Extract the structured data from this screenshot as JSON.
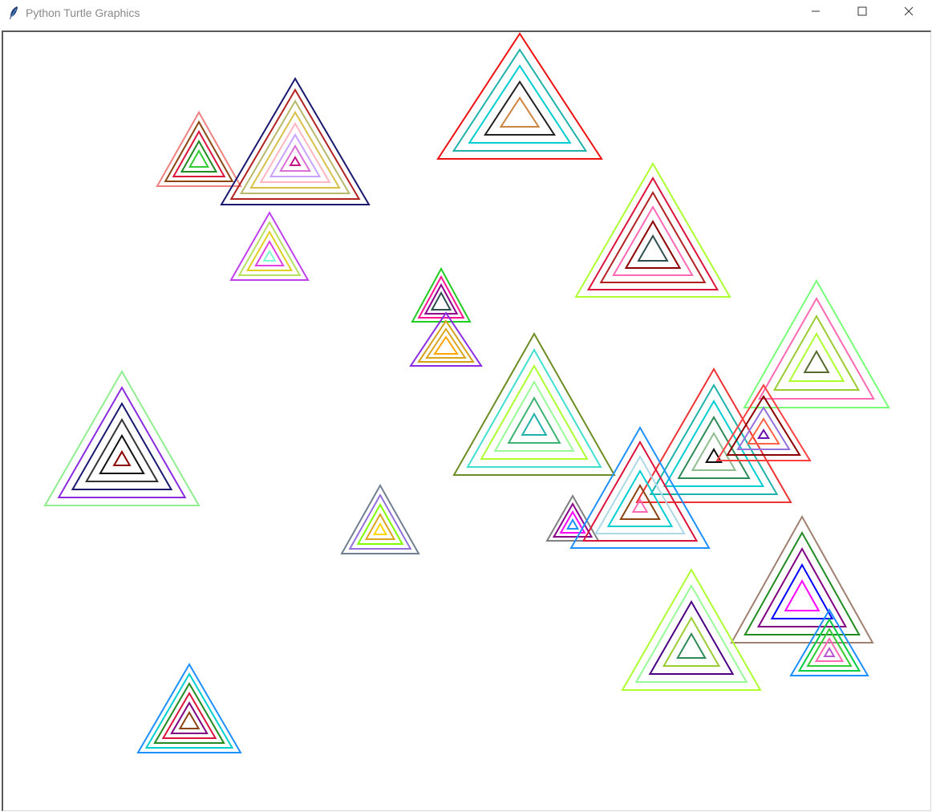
{
  "window": {
    "title": "Python Turtle Graphics",
    "icon": "feather-icon",
    "controls": {
      "minimize_icon": "minimize-icon",
      "maximize_icon": "maximize-icon",
      "close_icon": "close-icon"
    }
  },
  "canvas": {
    "background": "#ffffff",
    "description_shape": "nested-triangle",
    "triangle_groups": [
      {
        "colors": [
          "#f08080",
          "#8b4513",
          "#dc143c",
          "#228b22",
          "#32cd32",
          "#00c000",
          "#f0e68c",
          "#ffe4b5"
        ]
      },
      {
        "colors": [
          "#191970",
          "#b22222",
          "#b8b86b",
          "#d8c04a",
          "#ffb6c1",
          "#c8a2ff",
          "#da70d6",
          "#c71585",
          "#2e8b57",
          "#8fbc8f",
          "#4b0082",
          "#ff69b4"
        ]
      },
      {
        "colors": [
          "#ee1111",
          "#20b2aa",
          "#00ced1",
          "#222222",
          "#cd853f",
          "#4169e1",
          "#7cfc00"
        ]
      },
      {
        "colors": [
          "#c040f0",
          "#b8e060",
          "#e0d020",
          "#e040e0",
          "#7fffd4",
          "#20b2aa",
          "#00e0e0"
        ]
      },
      {
        "colors": [
          "#adff2f",
          "#dc143c",
          "#b22222",
          "#ff69b4",
          "#8b0000",
          "#2f4f4f",
          "#ee82ee"
        ]
      },
      {
        "colors": [
          "#22cc22",
          "#ff1493",
          "#8b008b",
          "#2f4f4f",
          "#1e90ff",
          "#ffffff"
        ]
      },
      {
        "colors": [
          "#8a2be2",
          "#d4a017",
          "#daa520",
          "#ffa500",
          "#1e1e8b",
          "#ff00ff"
        ]
      },
      {
        "colors": [
          "#77ff77",
          "#ff69b4",
          "#9acd32",
          "#adff2f",
          "#556b2f",
          "#0000cd"
        ]
      },
      {
        "colors": [
          "#90ee90",
          "#8a2be2",
          "#191970",
          "#333333",
          "#111111",
          "#8b0000",
          "#ee1111",
          "#8b5a5a"
        ]
      },
      {
        "colors": [
          "#6b8e23",
          "#40e0d0",
          "#adff2f",
          "#98fb98",
          "#3cb371",
          "#20b2aa",
          "#ff00ff"
        ]
      },
      {
        "colors": [
          "#ee3333",
          "#20b2aa",
          "#00ced1",
          "#2e8b57",
          "#8fbc8f",
          "#111111",
          "#7cfc00"
        ]
      },
      {
        "colors": [
          "#ff4040",
          "#8b0000",
          "#9370db",
          "#ff6347",
          "#6a0dad",
          "#87cefa",
          "#b0c4de"
        ]
      },
      {
        "colors": [
          "#708090",
          "#9370db",
          "#7fff00",
          "#daa520",
          "#ffd700",
          "#ff69b4",
          "#ba55d3"
        ]
      },
      {
        "colors": [
          "#808080",
          "#8b008b",
          "#ff00ff",
          "#1e90ff",
          "#006400",
          "#40e0d0"
        ]
      },
      {
        "colors": [
          "#1e90ff",
          "#dc143c",
          "#add8e6",
          "#00ced1",
          "#8b4513",
          "#ff69b4"
        ]
      },
      {
        "colors": [
          "#a08070",
          "#228b22",
          "#800080",
          "#0000ff",
          "#ff00ff",
          "#000000",
          "#9370db"
        ]
      },
      {
        "colors": [
          "#adff2f",
          "#98fb98",
          "#4b0082",
          "#9acd32",
          "#2e8b57",
          "#8b7d3a",
          "#f0c040"
        ]
      },
      {
        "colors": [
          "#1e90ff",
          "#00cc44",
          "#32cd32",
          "#ff69b4",
          "#ba55d3",
          "#8b5a5a",
          "#d4a017"
        ]
      },
      {
        "colors": [
          "#1e90ff",
          "#00ced1",
          "#228b22",
          "#dc143c",
          "#800080",
          "#8b4513",
          "#ee3333"
        ]
      }
    ]
  }
}
